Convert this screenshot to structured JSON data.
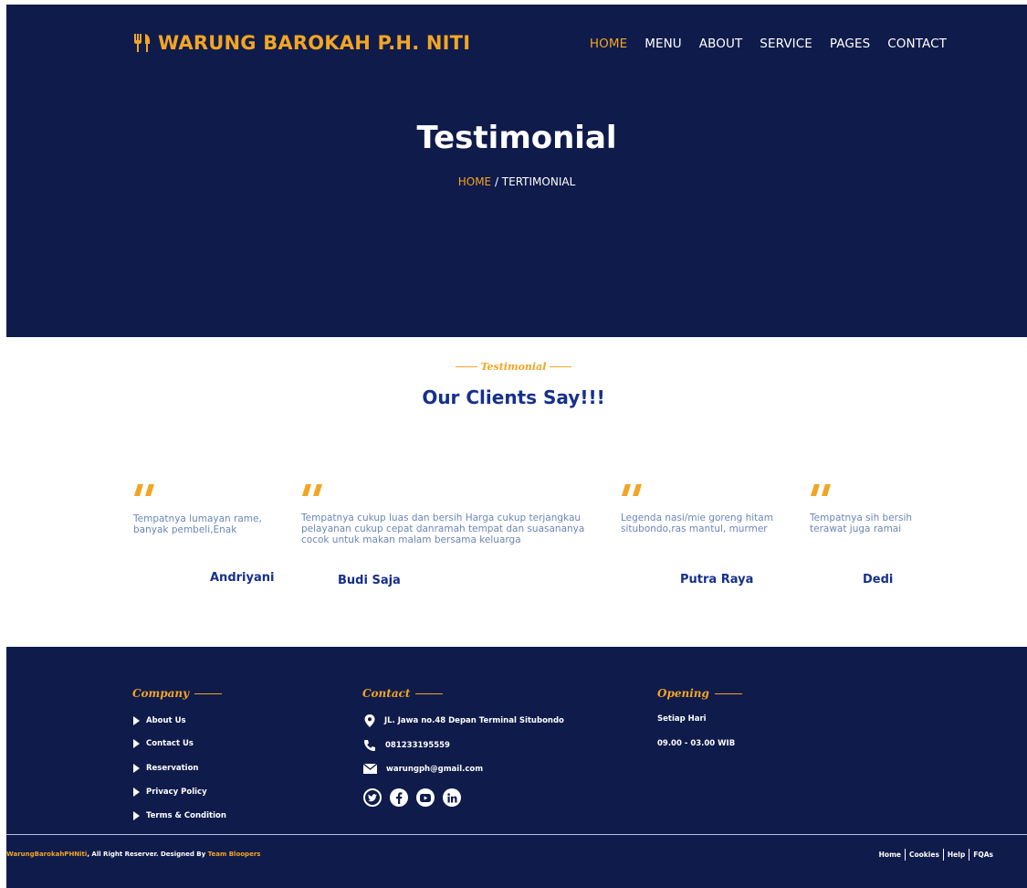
{
  "header": {
    "brand": "WARUNG BAROKAH P.H. NITI",
    "brand_icon": "fork-knife-icon",
    "nav": [
      {
        "label": "HOME",
        "active": true
      },
      {
        "label": "MENU",
        "active": false
      },
      {
        "label": "ABOUT",
        "active": false
      },
      {
        "label": "SERVICE",
        "active": false
      },
      {
        "label": "PAGES",
        "active": false
      },
      {
        "label": "CONTACT",
        "active": false
      }
    ]
  },
  "hero": {
    "title": "Testimonial",
    "breadcrumb_home": "HOME",
    "breadcrumb_sep": " / ",
    "breadcrumb_current": "TERTIMONIAL"
  },
  "section": {
    "kicker": "Testimonial",
    "title": "Our Clients Say!!!"
  },
  "testimonials": [
    {
      "text": "Tempatnya lumayan rame, banyak pembeli,Enak",
      "name": "Andriyani"
    },
    {
      "text": "Tempatnya cukup luas dan bersih Harga cukup terjangkau pelayanan cukup cepat danramah tempat dan suasananya cocok untuk makan malam bersama keluarga",
      "name": "Budi Saja"
    },
    {
      "text": "Legenda nasi/mie goreng hitam situbondo,ras mantul, murmer",
      "name": "Putra Raya"
    },
    {
      "text": "Tempatnya sih bersih terawat juga ramai",
      "name": "Dedi"
    }
  ],
  "footer": {
    "company": {
      "title": "Company",
      "links": [
        "About Us",
        "Contact Us",
        "Reservation",
        "Privacy Policy",
        "Terms & Condition"
      ]
    },
    "contact": {
      "title": "Contact",
      "address": "JL. Jawa no.48 Depan Terminal Situbondo",
      "phone": "081233195559",
      "email": "warungph@gmail.com",
      "socials": [
        "twitter-icon",
        "facebook-icon",
        "youtube-icon",
        "linkedin-icon"
      ]
    },
    "opening": {
      "title": "Opening",
      "days": "Setiap Hari",
      "hours": "09.00 - 03.00 WIB"
    },
    "copyright_brand": "WarungBarokahPHNiti",
    "copyright_text": ", All Right Reserver. Designed By ",
    "copyright_designer": "Team Bloopers",
    "bottom_links": [
      "Home",
      "Cookies",
      "Help",
      "FQAs"
    ]
  },
  "colors": {
    "navy": "#0f1b4a",
    "accent": "#f2a524",
    "title_blue": "#16308c",
    "body_text": "#6c86b5"
  }
}
